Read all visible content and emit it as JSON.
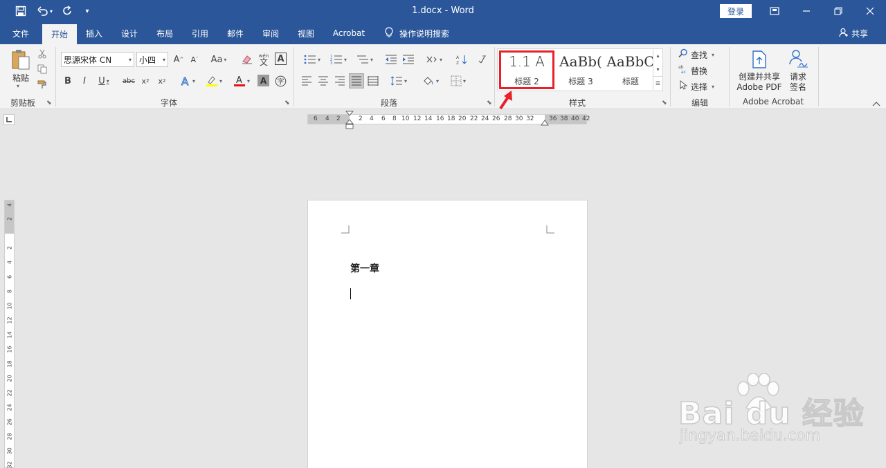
{
  "window": {
    "title": "1.docx  -  Word",
    "login_label": "登录"
  },
  "tabs": [
    "文件",
    "开始",
    "插入",
    "设计",
    "布局",
    "引用",
    "邮件",
    "审阅",
    "视图",
    "Acrobat"
  ],
  "active_tab": "开始",
  "tell_me": "操作说明搜索",
  "share_label": "共享",
  "ribbon": {
    "clipboard": {
      "paste_label": "粘贴",
      "group_label": "剪贴板"
    },
    "font": {
      "font_name": "思源宋体 CN",
      "font_size": "小四",
      "case_label": "Aa",
      "group_label": "字体",
      "wen_label": "wén",
      "wen_char": "文",
      "big_a": "A"
    },
    "paragraph": {
      "group_label": "段落"
    },
    "styles": {
      "group_label": "样式",
      "items": [
        {
          "sample": "1.1   A",
          "name": "标题 2"
        },
        {
          "sample": "AaBb(",
          "name": "标题 3"
        },
        {
          "sample": "AaBbC",
          "name": "标题"
        }
      ]
    },
    "editing": {
      "find": "查找",
      "replace": "替换",
      "select": "选择",
      "group_label": "编辑"
    },
    "acrobat": {
      "create_label": "创建并共享",
      "create_label2": "Adobe PDF",
      "sign_label": "请求",
      "sign_label2": "签名",
      "group_label": "Adobe Acrobat"
    }
  },
  "ruler": {
    "h_left": [
      "6",
      "4",
      "2"
    ],
    "h_main": [
      "2",
      "4",
      "6",
      "8",
      "10",
      "12",
      "14",
      "16",
      "18",
      "20",
      "22",
      "24",
      "26",
      "28",
      "30",
      "32"
    ],
    "h_right": [
      "36",
      "38",
      "40",
      "42"
    ],
    "v_top": [
      "4",
      "2"
    ],
    "v_main": [
      "2",
      "4",
      "6",
      "8",
      "10",
      "12",
      "14",
      "16",
      "18",
      "20",
      "22",
      "24",
      "26",
      "28",
      "30",
      "32"
    ]
  },
  "document": {
    "heading": "第一章"
  },
  "watermark": {
    "main": "Bai du 经验",
    "sub": "jingyan.baidu.com"
  },
  "colors": {
    "accent": "#2b579a",
    "highlight": "#e8202a"
  }
}
